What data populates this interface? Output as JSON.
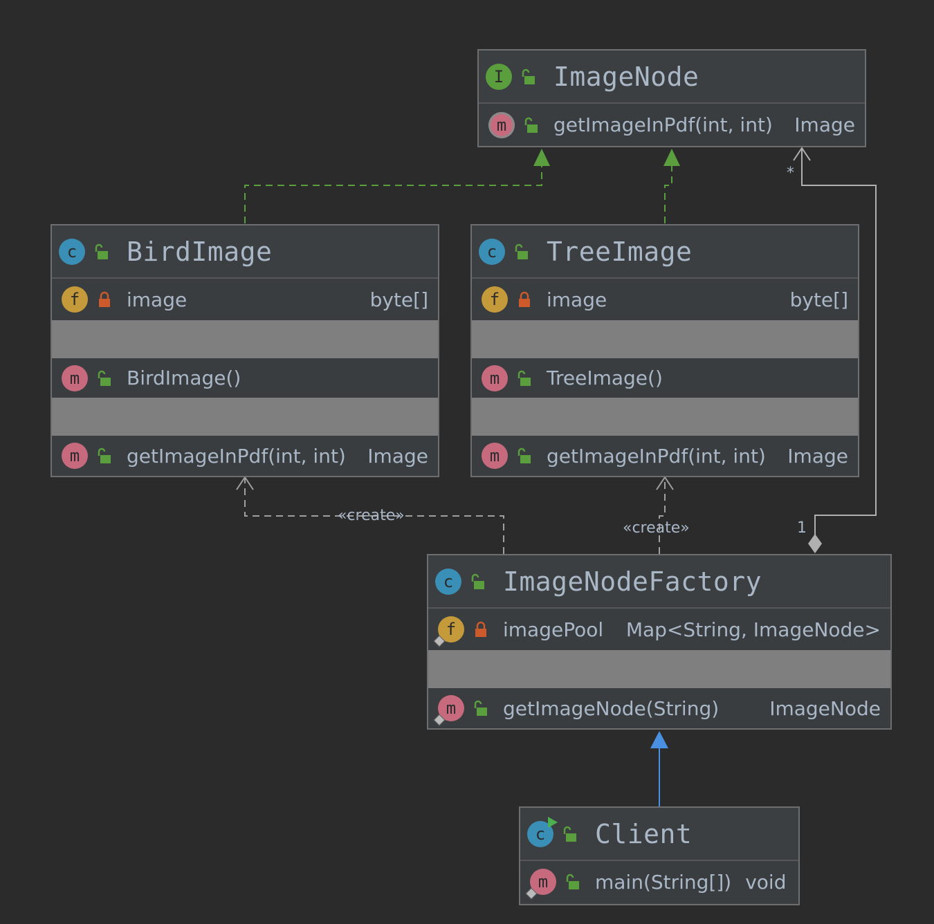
{
  "colors": {
    "background": "#2b2b2b",
    "implements_arrow": "#5a9e3e",
    "inherits_arrow": "#4a90e2",
    "dependency_line": "#a0a0a0",
    "class_badge": "#3a8fb7",
    "interface_badge": "#5a9e3e",
    "field_badge": "#c49a3a",
    "method_badge": "#c76a7e",
    "public_icon": "#5a9e3e",
    "private_icon": "#cc5a2a"
  },
  "nodes": {
    "image_node": {
      "badge": "I",
      "name": "ImageNode",
      "methods": [
        {
          "label": "getImageInPdf(int, int)",
          "type": "Image",
          "badge": "m"
        }
      ]
    },
    "bird_image": {
      "badge": "c",
      "name": "BirdImage",
      "fields": [
        {
          "label": "image",
          "type": "byte[]",
          "badge": "f"
        }
      ],
      "constructors": [
        {
          "label": "BirdImage()",
          "badge": "m"
        }
      ],
      "methods": [
        {
          "label": "getImageInPdf(int, int)",
          "type": "Image",
          "badge": "m"
        }
      ]
    },
    "tree_image": {
      "badge": "c",
      "name": "TreeImage",
      "fields": [
        {
          "label": "image",
          "type": "byte[]",
          "badge": "f"
        }
      ],
      "constructors": [
        {
          "label": "TreeImage()",
          "badge": "m"
        }
      ],
      "methods": [
        {
          "label": "getImageInPdf(int, int)",
          "type": "Image",
          "badge": "m"
        }
      ]
    },
    "image_node_factory": {
      "badge": "c",
      "name": "ImageNodeFactory",
      "fields": [
        {
          "label": "imagePool",
          "type": "Map<String, ImageNode>",
          "badge": "f"
        }
      ],
      "methods": [
        {
          "label": "getImageNode(String)",
          "type": "ImageNode",
          "badge": "m"
        }
      ]
    },
    "client": {
      "badge": "c",
      "name": "Client",
      "methods": [
        {
          "label": "main(String[])",
          "type": "void",
          "badge": "m"
        }
      ]
    }
  },
  "edges": {
    "create_bird": "«create»",
    "create_tree": "«create»",
    "multiplicity_many": "*",
    "multiplicity_one": "1"
  }
}
